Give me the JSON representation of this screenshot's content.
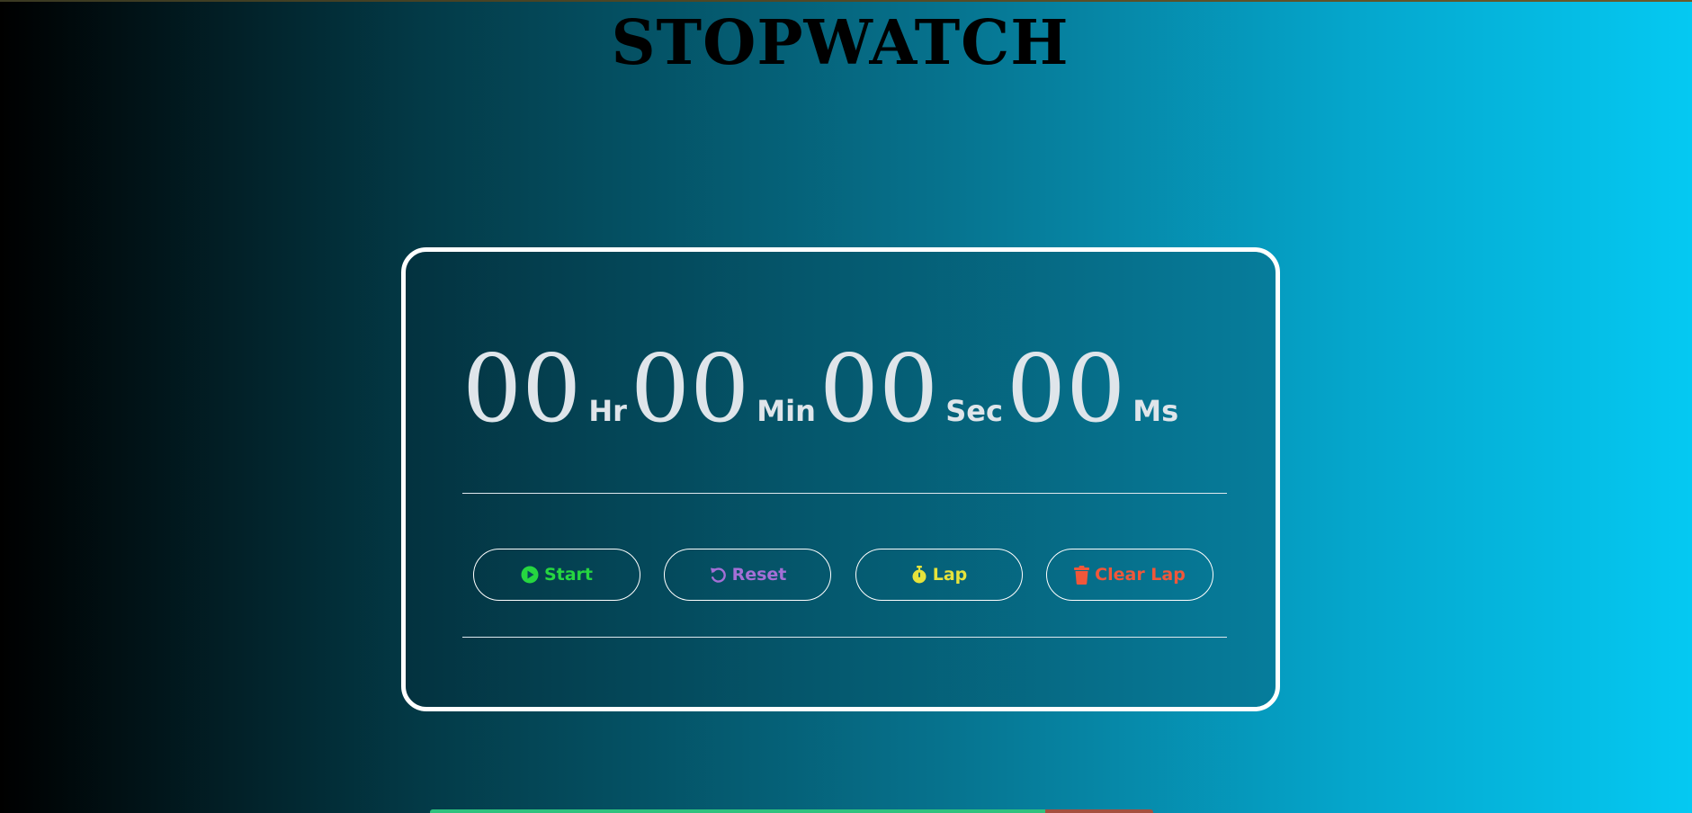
{
  "page": {
    "title": "STOPWATCH"
  },
  "display": {
    "hours": "00",
    "hours_unit": "Hr",
    "minutes": "00",
    "minutes_unit": "Min",
    "seconds": "00",
    "seconds_unit": "Sec",
    "milliseconds": "00",
    "milliseconds_unit": "Ms"
  },
  "controls": {
    "start": {
      "label": "Start",
      "icon": "play-circle-icon",
      "color": "#26d640"
    },
    "reset": {
      "label": "Reset",
      "icon": "rotate-left-icon",
      "color": "#a46fd6"
    },
    "lap": {
      "label": "Lap",
      "icon": "stopwatch-icon",
      "color": "#e6e33b"
    },
    "clear_lap": {
      "label": "Clear Lap",
      "icon": "trash-icon",
      "color": "#f0573a"
    }
  },
  "colors": {
    "background_left": "#000000",
    "background_right": "#05c9f2",
    "card_border": "#ffffff",
    "digits": "#dfe5ea"
  }
}
